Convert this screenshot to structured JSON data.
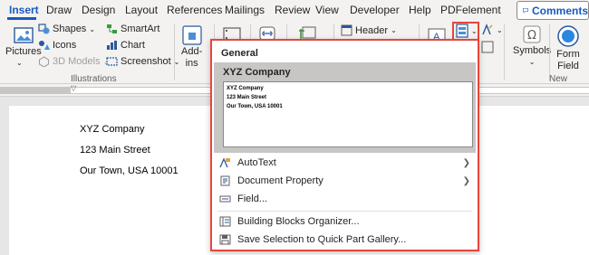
{
  "tabs": [
    {
      "label": "Insert",
      "active": true
    },
    {
      "label": "Draw"
    },
    {
      "label": "Design"
    },
    {
      "label": "Layout"
    },
    {
      "label": "References"
    },
    {
      "label": "Mailings"
    },
    {
      "label": "Review"
    },
    {
      "label": "View"
    },
    {
      "label": "Developer"
    },
    {
      "label": "Help"
    },
    {
      "label": "PDFelement"
    }
  ],
  "comments_label": "Comments",
  "ribbon": {
    "pictures": "Pictures",
    "shapes": "Shapes",
    "icons": "Icons",
    "models3d": "3D Models",
    "smartart": "SmartArt",
    "chart": "Chart",
    "screenshot": "Screenshot",
    "illustrations_group": "Illustrations",
    "addins_line1": "Add-",
    "addins_line2": "ins",
    "header": "Header",
    "symbols": "Symbols",
    "form_line1": "Form",
    "form_line2": "Field",
    "new_group": "New Group"
  },
  "document": {
    "lines": [
      "XYZ Company",
      "123 Main Street",
      "Our Town, USA 10001"
    ]
  },
  "quick_parts": {
    "section_header": "General",
    "gallery_title": "XYZ Company",
    "preview_lines": [
      "XYZ Company",
      "123 Main Street",
      "Our Town, USA 10001"
    ],
    "menu": [
      {
        "label": "AutoText",
        "submenu": true,
        "icon": "autotext-icon"
      },
      {
        "label": "Document Property",
        "submenu": true,
        "icon": "document-property-icon"
      },
      {
        "label": "Field...",
        "submenu": false,
        "icon": "field-icon"
      },
      {
        "label": "Building Blocks Organizer...",
        "submenu": false,
        "icon": "building-blocks-icon"
      },
      {
        "label": "Save Selection to Quick Part Gallery...",
        "submenu": false,
        "icon": "save-selection-icon"
      }
    ]
  },
  "colors": {
    "accent": "#185abd",
    "highlight": "#e8453c"
  }
}
